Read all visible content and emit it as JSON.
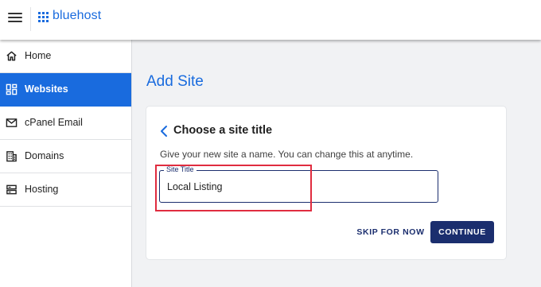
{
  "header": {
    "menu_icon": "hamburger-menu-icon",
    "logo_icon": "bluehost-grid-logo-icon",
    "logo_text": "bluehost",
    "brand_color": "#196bde"
  },
  "sidebar": {
    "items": [
      {
        "label": "Home",
        "icon": "home-icon",
        "active": false
      },
      {
        "label": "Websites",
        "icon": "dashboard-grid-icon",
        "active": true
      },
      {
        "label": "cPanel Email",
        "icon": "envelope-icon",
        "active": false
      },
      {
        "label": "Domains",
        "icon": "building-icon",
        "active": false
      },
      {
        "label": "Hosting",
        "icon": "server-icon",
        "active": false
      }
    ],
    "active_color": "#196bde"
  },
  "main": {
    "page_title": "Add Site",
    "card": {
      "back_icon": "chevron-left-icon",
      "heading": "Choose a site title",
      "description": "Give your new site a name. You can change this at anytime.",
      "field": {
        "label": "Site Title",
        "value": "Local Listing"
      },
      "highlight_color": "#e02c3f",
      "skip_label": "SKIP FOR NOW",
      "continue_label": "CONTINUE",
      "button_color": "#1b2e6e"
    }
  }
}
